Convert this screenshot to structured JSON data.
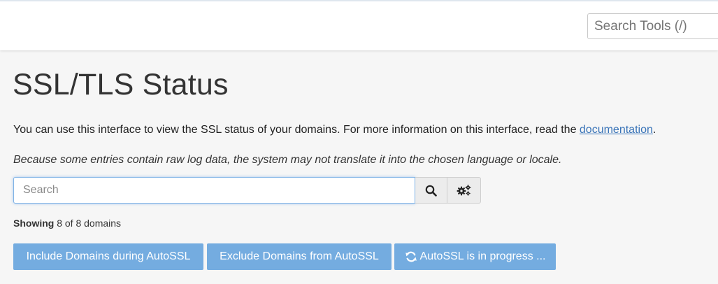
{
  "header": {
    "tools_search_placeholder": "Search Tools (/)"
  },
  "page": {
    "title": "SSL/TLS Status",
    "intro_text": "You can use this interface to view the SSL status of your domains. For more information on this interface, read the ",
    "intro_link": "documentation",
    "intro_end": ".",
    "note": "Because some entries contain raw log data, the system may not translate it into the chosen language or locale."
  },
  "search": {
    "placeholder": "Search",
    "search_icon": "search-icon",
    "settings_icon": "gears-icon"
  },
  "results": {
    "showing_label": "Showing",
    "showing_count": "8 of 8 domains"
  },
  "actions": {
    "include_label": "Include Domains during AutoSSL",
    "exclude_label": "Exclude Domains from AutoSSL",
    "progress_label": "AutoSSL is in progress ...",
    "progress_icon": "refresh-icon"
  },
  "colors": {
    "button_bg": "#74ace0",
    "link": "#3a74b8",
    "focus_border": "#7fb3e6"
  }
}
